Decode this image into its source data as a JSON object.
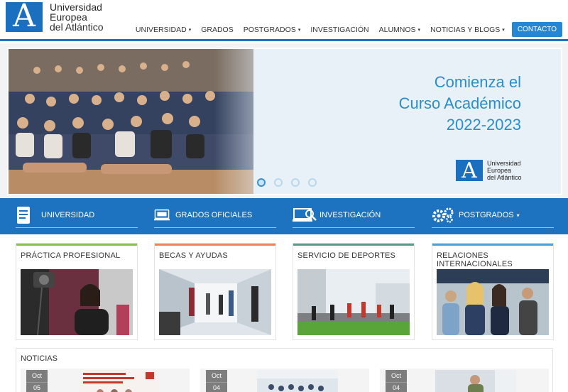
{
  "logo": {
    "line1": "Universidad",
    "line2": "Europea",
    "line3": "del Atlántico",
    "mark": "A"
  },
  "nav": {
    "items": [
      {
        "label": "UNIVERSIDAD",
        "caret": "▾"
      },
      {
        "label": "GRADOS",
        "caret": ""
      },
      {
        "label": "POSTGRADOS",
        "caret": "▾"
      },
      {
        "label": "INVESTIGACIÓN",
        "caret": ""
      },
      {
        "label": "ALUMNOS",
        "caret": "▾"
      },
      {
        "label": "NOTICIAS Y BLOGS",
        "caret": "▾"
      }
    ],
    "contact": "CONTACTO"
  },
  "hero": {
    "line1": "Comienza el",
    "line2": "Curso Académico",
    "line3": "2022-2023",
    "logo_line1": "Universidad",
    "logo_line2": "Europea",
    "logo_line3": "del Atlántico",
    "slide_count": 4,
    "active_slide": 1
  },
  "bluebar": {
    "items": [
      {
        "label": "UNIVERSIDAD",
        "icon": "document-icon"
      },
      {
        "label": "GRADOS OFICIALES",
        "icon": "monitor-icon"
      },
      {
        "label": "INVESTIGACIÓN",
        "icon": "laptop-search-icon"
      },
      {
        "label": "POSTGRADOS",
        "icon": "gears-icon",
        "caret": "▾"
      }
    ]
  },
  "cards": [
    {
      "title": "PRÁCTICA PROFESIONAL",
      "accent": "#8cc152"
    },
    {
      "title": "BECAS Y AYUDAS",
      "accent": "#f0855a"
    },
    {
      "title": "SERVICIO DE DEPORTES",
      "accent": "#5a9a8a"
    },
    {
      "title": "RELACIONES INTERNACIONALES",
      "accent": "#4aa3df"
    }
  ],
  "news": {
    "heading": "NOTICIAS",
    "items": [
      {
        "month": "Oct",
        "day": "05"
      },
      {
        "month": "Oct",
        "day": "04"
      },
      {
        "month": "Oct",
        "day": "04"
      }
    ]
  },
  "colors": {
    "brand": "#1d73c0",
    "accent_text": "#2a8ec8",
    "contact": "#2387d6"
  }
}
